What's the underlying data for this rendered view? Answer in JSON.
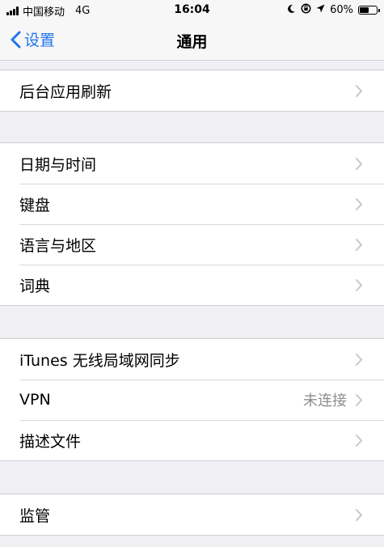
{
  "status": {
    "carrier": "中国移动",
    "network": "4G",
    "time": "16:04",
    "battery": "60%",
    "battery_level": 0.6,
    "icons": [
      "signal-icon",
      "moon-icon",
      "rotation-lock-icon",
      "location-icon",
      "battery-icon"
    ]
  },
  "nav": {
    "back_label": "设置",
    "title": "通用",
    "accent": "#1f74f0"
  },
  "groups": [
    {
      "items": [
        {
          "label": "后台应用刷新"
        }
      ]
    },
    {
      "items": [
        {
          "label": "日期与时间"
        },
        {
          "label": "键盘"
        },
        {
          "label": "语言与地区"
        },
        {
          "label": "词典"
        }
      ]
    },
    {
      "items": [
        {
          "label": "iTunes 无线局域网同步"
        },
        {
          "label": "VPN",
          "value": "未连接"
        },
        {
          "label": "描述文件"
        }
      ]
    },
    {
      "items": [
        {
          "label": "监管"
        }
      ]
    }
  ]
}
